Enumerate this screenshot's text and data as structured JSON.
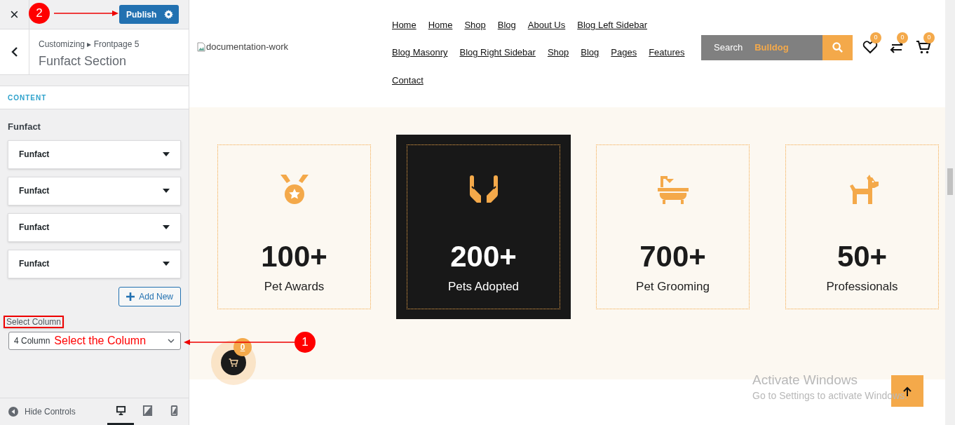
{
  "customizer": {
    "close": "×",
    "publish": "Publish",
    "breadcrumb": "Customizing ▸ Frontpage 5",
    "section_title": "Funfact Section",
    "content_heading": "CONTENT",
    "group_label": "Funfact",
    "accordions": [
      {
        "label": "Funfact",
        "expanded": false
      },
      {
        "label": "Funfact",
        "expanded": false
      },
      {
        "label": "Funfact",
        "expanded": false
      },
      {
        "label": "Funfact",
        "expanded": false
      }
    ],
    "add_new": "Add New",
    "select_label": "Select Column",
    "select_value": "4 Column",
    "select_callout": "Select the Column",
    "hide_controls": "Hide Controls",
    "devices": [
      {
        "kind": "desktop",
        "selected": true
      },
      {
        "kind": "tablet",
        "selected": false
      },
      {
        "kind": "mobile",
        "selected": false
      }
    ]
  },
  "annotations": [
    {
      "number": "2"
    },
    {
      "number": "1"
    }
  ],
  "preview": {
    "logo_alt": "documentation-work",
    "nav_rows": [
      [
        "Home",
        "Home",
        "Shop",
        "Blog",
        "About Us",
        "Blog Left Sidebar"
      ],
      [
        "Blog Masonry",
        "Blog Right Sidebar",
        "Shop",
        "Blog",
        "Pages",
        "Features"
      ],
      [
        "Contact"
      ]
    ],
    "search": {
      "placeholder": "Search",
      "value": "Bulldog"
    },
    "header_icons": [
      {
        "kind": "heart",
        "count": "0"
      },
      {
        "kind": "compare",
        "count": "0"
      },
      {
        "kind": "cart",
        "count": "0"
      }
    ],
    "funfacts": [
      {
        "number": "100+",
        "label": "Pet Awards",
        "highlighted": false
      },
      {
        "number": "200+",
        "label": "Pets Adopted",
        "highlighted": true
      },
      {
        "number": "700+",
        "label": "Pet Grooming",
        "highlighted": false
      },
      {
        "number": "50+",
        "label": "Professionals",
        "highlighted": false
      }
    ],
    "floating_cart_count": "0"
  },
  "os_notice": {
    "title": "Activate Windows",
    "text": "Go to Settings to activate Windows."
  }
}
